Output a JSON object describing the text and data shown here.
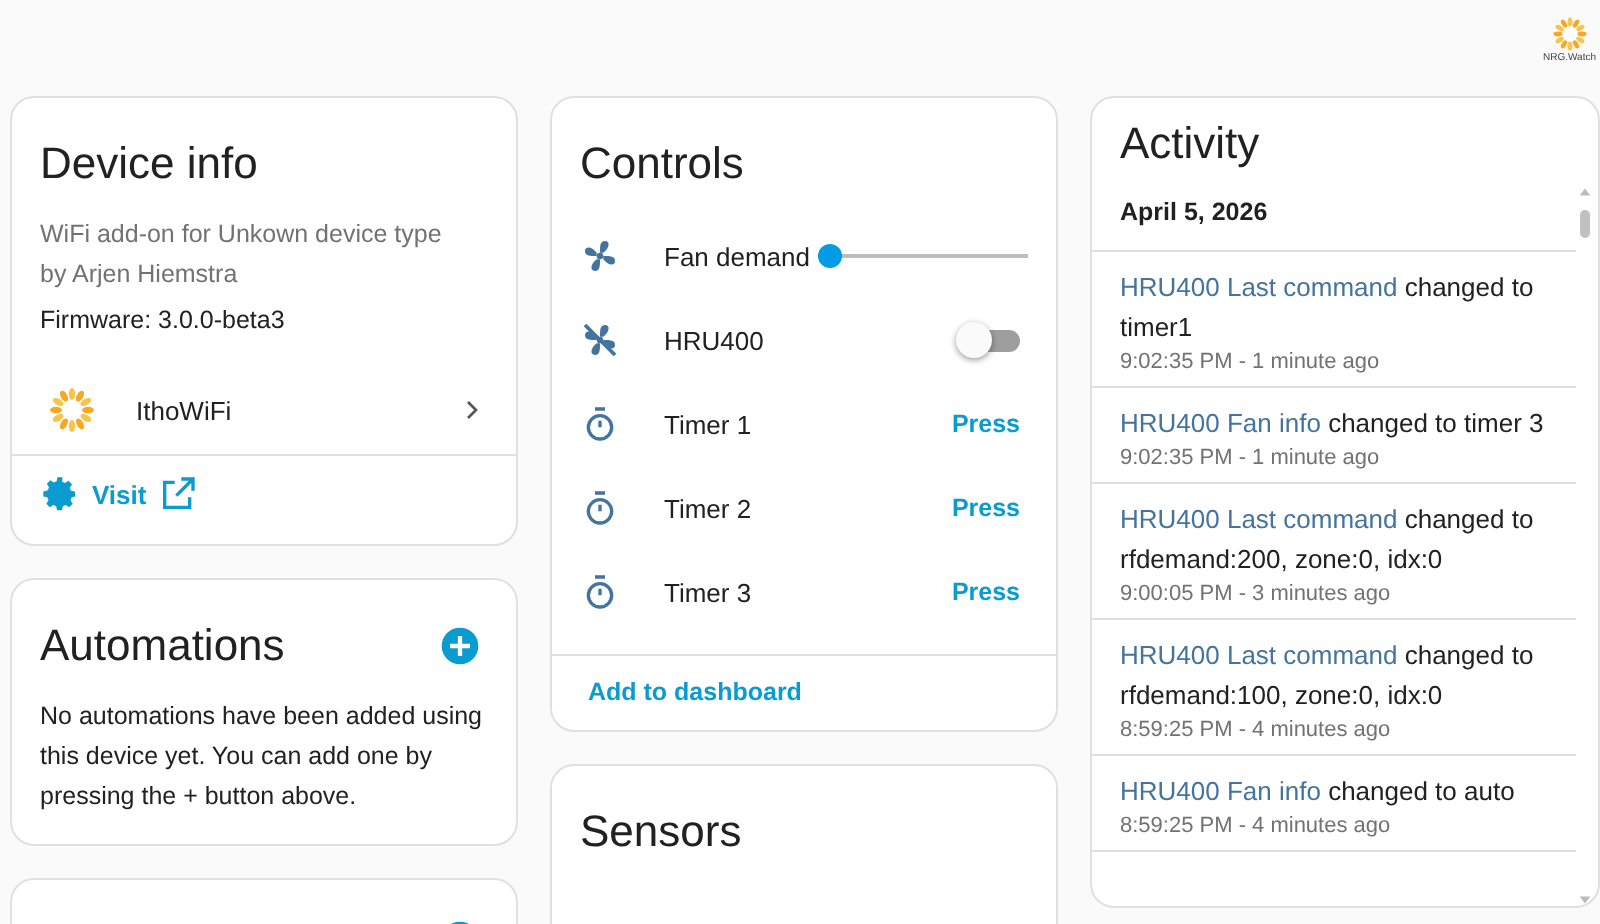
{
  "logo": {
    "caption": "NRG.Watch"
  },
  "device_info": {
    "title": "Device info",
    "description": [
      "WiFi add-on for Unkown device type",
      "by Arjen Hiemstra"
    ],
    "firmware": "Firmware: 3.0.0-beta3",
    "integration": "IthoWiFi",
    "visit": "Visit"
  },
  "automations": {
    "title": "Automations",
    "text": "No automations have been added using this device yet. You can add one by pressing the + button above."
  },
  "controls": {
    "title": "Controls",
    "items": [
      {
        "kind": "slider",
        "label": "Fan demand",
        "level": 0.0
      },
      {
        "kind": "toggle",
        "label": "HRU400",
        "on": false
      },
      {
        "kind": "button",
        "label": "Timer 1",
        "action": "Press"
      },
      {
        "kind": "button",
        "label": "Timer 2",
        "action": "Press"
      },
      {
        "kind": "button",
        "label": "Timer 3",
        "action": "Press"
      }
    ],
    "footer": "Add to dashboard"
  },
  "sensors": {
    "title": "Sensors"
  },
  "activity": {
    "title": "Activity",
    "date": "April 5, 2026",
    "entries": [
      {
        "entity": "HRU400 Last command",
        "message": "changed to timer1",
        "time": "9:02:35 PM - 1 minute ago"
      },
      {
        "entity": "HRU400 Fan info",
        "message": "changed to timer 3",
        "time": "9:02:35 PM - 1 minute ago"
      },
      {
        "entity": "HRU400 Last command",
        "message": "changed to rfdemand:200, zone:0, idx:0",
        "time": "9:00:05 PM - 3 minutes ago"
      },
      {
        "entity": "HRU400 Last command",
        "message": "changed to rfdemand:100, zone:0, idx:0",
        "time": "8:59:25 PM - 4 minutes ago"
      },
      {
        "entity": "HRU400 Fan info",
        "message": "changed to auto",
        "time": "8:59:25 PM - 4 minutes ago"
      }
    ]
  }
}
